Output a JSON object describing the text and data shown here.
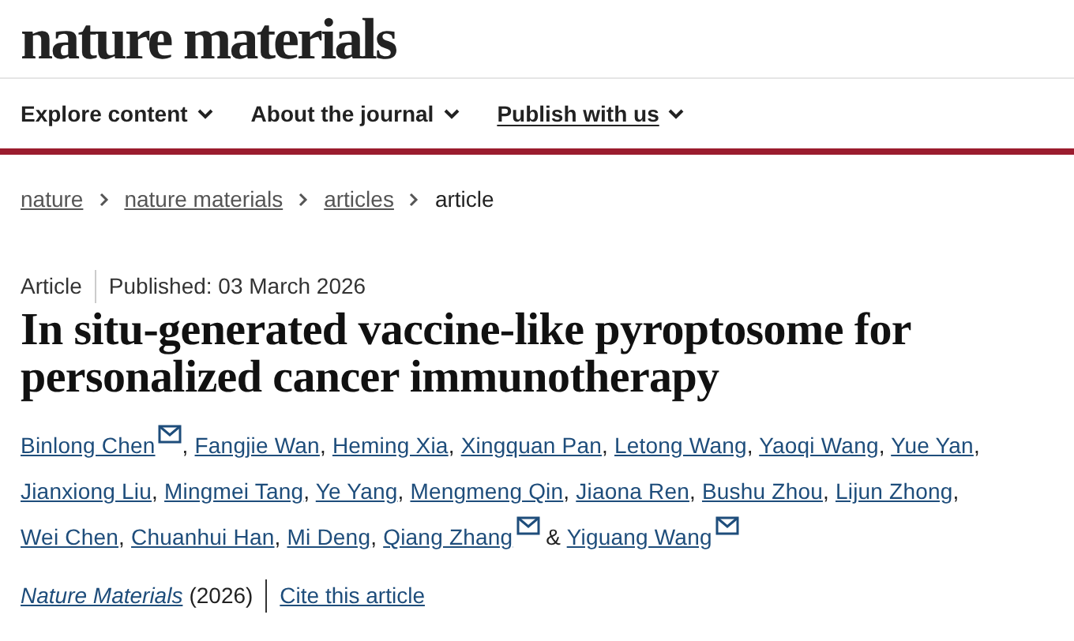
{
  "logo": "nature materials",
  "nav": [
    {
      "label": "Explore content",
      "selected": false
    },
    {
      "label": "About the journal",
      "selected": false
    },
    {
      "label": "Publish with us",
      "selected": true
    }
  ],
  "breadcrumbs": [
    {
      "label": "nature",
      "link": true
    },
    {
      "label": "nature materials",
      "link": true
    },
    {
      "label": "articles",
      "link": true
    },
    {
      "label": "article",
      "link": false
    }
  ],
  "article_type": "Article",
  "published": "Published: 03 March 2026",
  "title": "In situ-generated vaccine-like pyroptosome for personalized cancer immunotherapy",
  "author_separator": ",",
  "last_separator": "&",
  "authors": [
    {
      "name": "Binlong Chen",
      "email": true
    },
    {
      "name": "Fangjie Wan",
      "email": false
    },
    {
      "name": "Heming Xia",
      "email": false
    },
    {
      "name": "Xingquan Pan",
      "email": false
    },
    {
      "name": "Letong Wang",
      "email": false
    },
    {
      "name": "Yaoqi Wang",
      "email": false
    },
    {
      "name": "Yue Yan",
      "email": false
    },
    {
      "name": "Jianxiong Liu",
      "email": false
    },
    {
      "name": "Mingmei Tang",
      "email": false
    },
    {
      "name": "Ye Yang",
      "email": false
    },
    {
      "name": "Mengmeng Qin",
      "email": false
    },
    {
      "name": "Jiaona Ren",
      "email": false
    },
    {
      "name": "Bushu Zhou",
      "email": false
    },
    {
      "name": "Lijun Zhong",
      "email": false
    },
    {
      "name": "Wei Chen",
      "email": false
    },
    {
      "name": "Chuanhui Han",
      "email": false
    },
    {
      "name": "Mi Deng",
      "email": false
    },
    {
      "name": "Qiang Zhang",
      "email": true
    },
    {
      "name": "Yiguang Wang",
      "email": true
    }
  ],
  "journal": "Nature Materials",
  "year": "(2026)",
  "cite": "Cite this article"
}
